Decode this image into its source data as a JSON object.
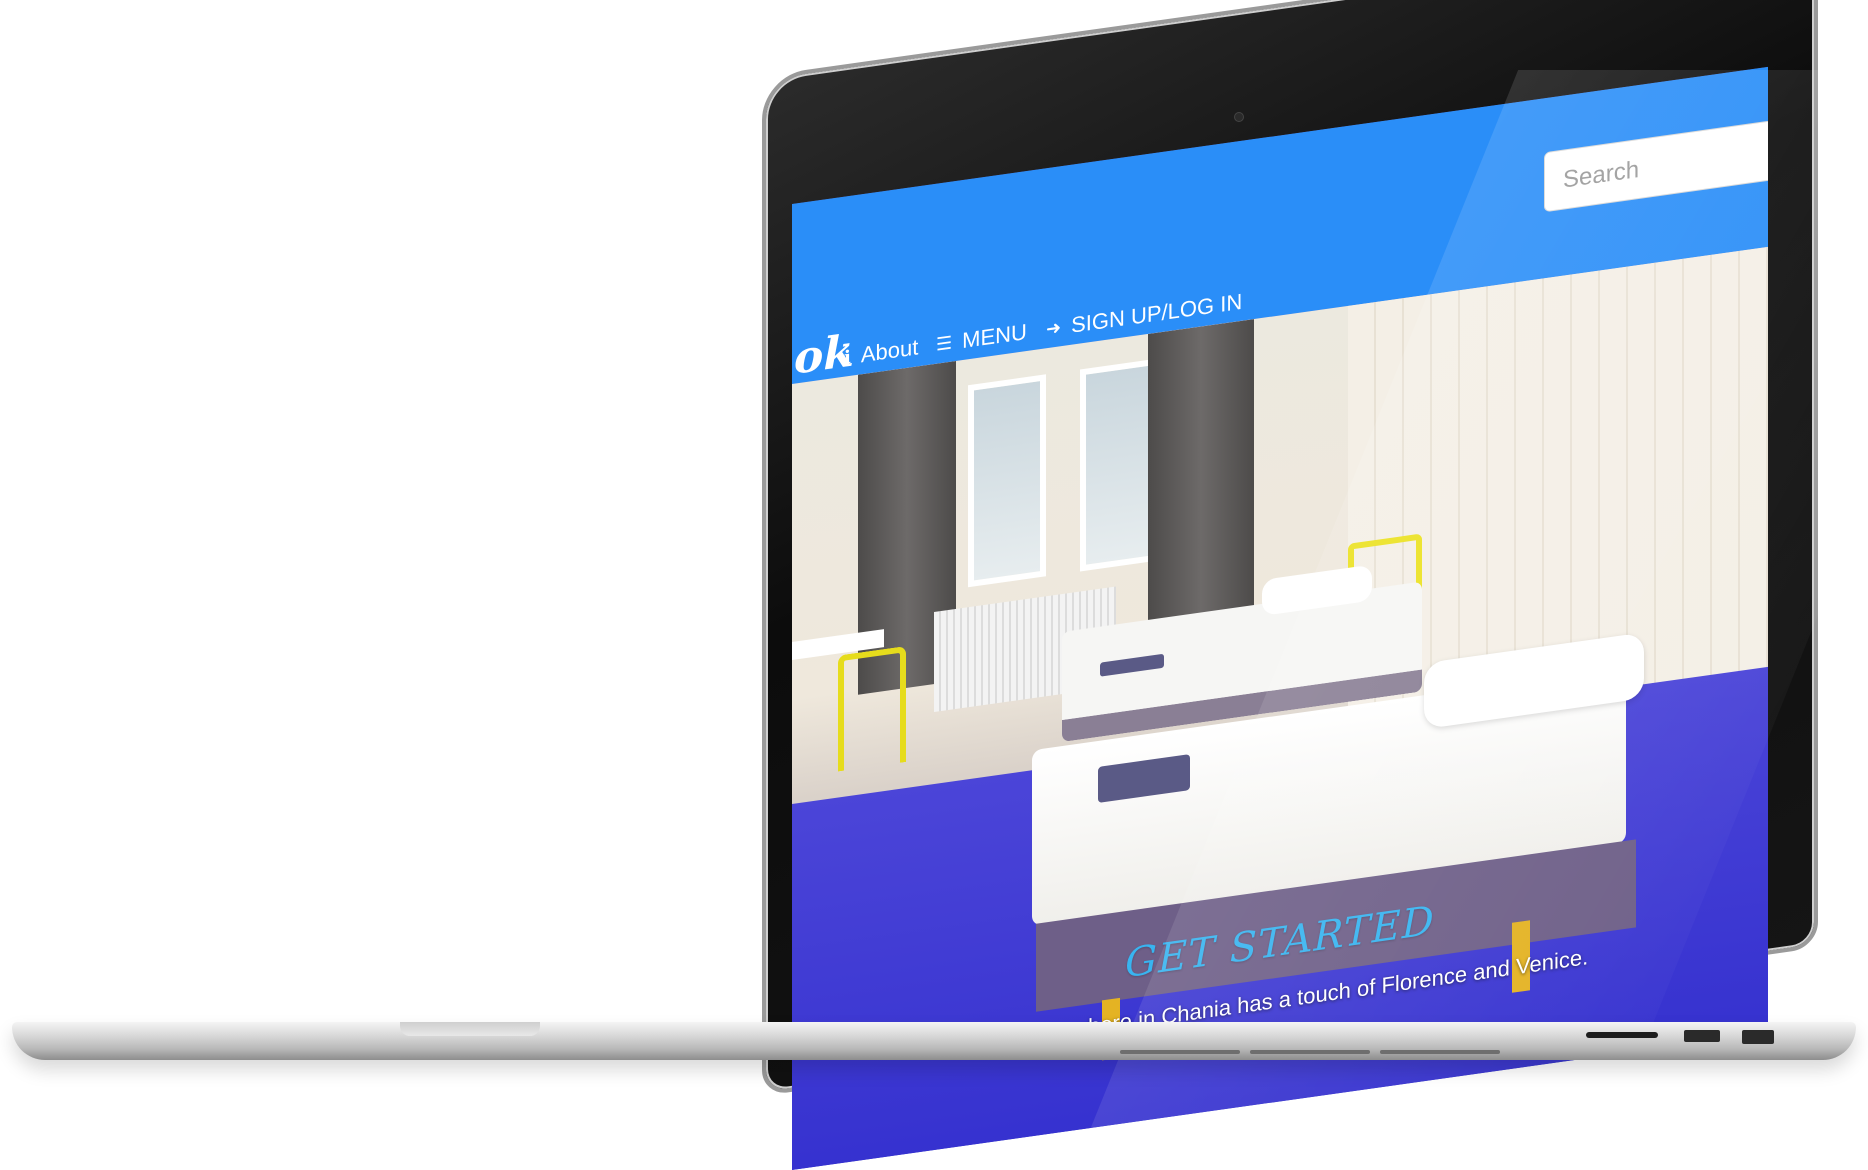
{
  "browser_page": {
    "logo_fragment": "ok",
    "nav": {
      "about": {
        "icon": "info-icon",
        "label": "About"
      },
      "menu": {
        "icon": "list-icon",
        "label": "MENU"
      },
      "signup": {
        "icon": "sign-in-icon",
        "label": "SIGN UP/LOG IN"
      }
    },
    "search": {
      "placeholder": "Search"
    },
    "carousel": {
      "title": "GET STARTED",
      "caption": "The atmosphere in Chania has a touch of Florence and Venice.",
      "slide_count": 3,
      "active_slide": 1
    }
  },
  "colors": {
    "navbar": "#2a8ef8",
    "caption_title": "#38b4f0",
    "floor": "#3a36d6"
  }
}
